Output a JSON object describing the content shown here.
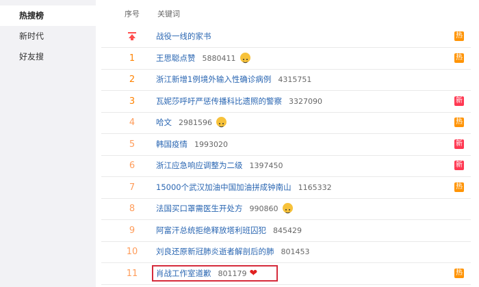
{
  "sidebar": {
    "items": [
      {
        "label": "热搜榜",
        "active": true
      },
      {
        "label": "新时代",
        "active": false
      },
      {
        "label": "好友搜",
        "active": false
      }
    ]
  },
  "header": {
    "rank_col": "序号",
    "keyword_col": "关键词"
  },
  "rows": [
    {
      "rank": "",
      "pinned": true,
      "text": "战役一线的家书",
      "count": "",
      "icon": "",
      "badge": "热",
      "badge_type": "hot"
    },
    {
      "rank": "1",
      "text": "王思聪点赞",
      "count": "5880411",
      "icon": "emoji-face-icon",
      "badge": "热",
      "badge_type": "hot"
    },
    {
      "rank": "2",
      "text": "浙江新增1例境外输入性确诊病例",
      "count": "4315751",
      "icon": "",
      "badge": "",
      "badge_type": ""
    },
    {
      "rank": "3",
      "text": "瓦妮莎呼吁严惩传播科比遗照的警察",
      "count": "3327090",
      "icon": "",
      "badge": "新",
      "badge_type": "new"
    },
    {
      "rank": "4",
      "text": "哈文",
      "count": "2981596",
      "icon": "emoji-face-icon",
      "badge": "热",
      "badge_type": "hot"
    },
    {
      "rank": "5",
      "text": "韩国疫情",
      "count": "1993020",
      "icon": "",
      "badge": "新",
      "badge_type": "new"
    },
    {
      "rank": "6",
      "text": "浙江应急响应调整为二级",
      "count": "1397450",
      "icon": "",
      "badge": "新",
      "badge_type": "new"
    },
    {
      "rank": "7",
      "text": "15000个武汉加油中国加油拼成钟南山",
      "count": "1165332",
      "icon": "",
      "badge": "热",
      "badge_type": "hot"
    },
    {
      "rank": "8",
      "text": "法国买口罩需医生开处方",
      "count": "990860",
      "icon": "emoji-face-icon",
      "badge": "",
      "badge_type": ""
    },
    {
      "rank": "9",
      "text": "阿富汗总统拒绝释放塔利班囚犯",
      "count": "845429",
      "icon": "",
      "badge": "",
      "badge_type": ""
    },
    {
      "rank": "10",
      "text": "刘良还原新冠肺炎逝者解剖后的肺",
      "count": "801453",
      "icon": "",
      "badge": "",
      "badge_type": ""
    },
    {
      "rank": "11",
      "text": "肖战工作室道歉",
      "count": "801179",
      "icon": "heart-icon",
      "badge": "热",
      "badge_type": "hot",
      "highlighted": true
    }
  ],
  "colors": {
    "rank_orange": "#ff8200",
    "link_blue": "#2a66b2",
    "badge_hot": "#ff9406",
    "badge_new": "#ff3852",
    "highlight_border": "#d52a3a",
    "sidebar_bg": "#f2f2f5"
  }
}
